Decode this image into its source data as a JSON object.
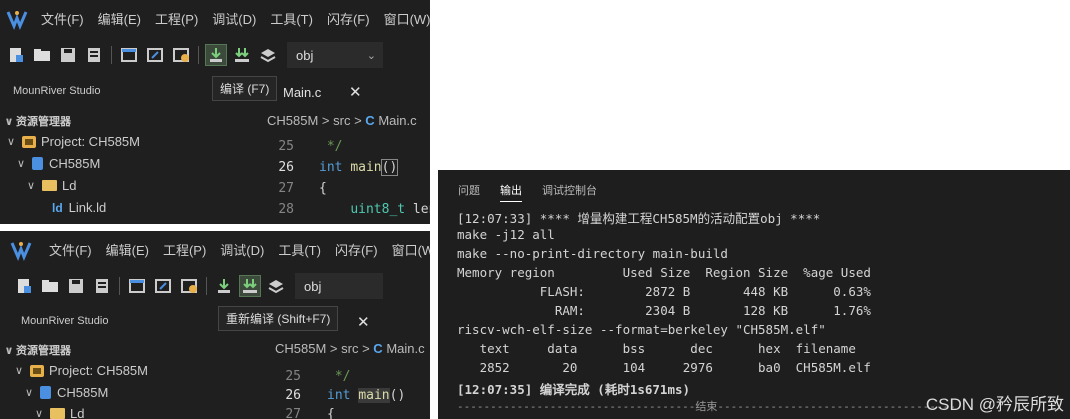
{
  "menu": [
    "文件(F)",
    "编辑(E)",
    "工程(P)",
    "调试(D)",
    "工具(T)",
    "闪存(F)",
    "窗口(W)"
  ],
  "toolbar": {
    "config_value": "obj"
  },
  "top": {
    "tooltip": "编译 (F7)",
    "tab_label": "Main.c",
    "sidebar_title": "MounRiver Studio",
    "explorer_header": "资源管理器",
    "tree": [
      {
        "label": "Project: CH585M"
      },
      {
        "label": "CH585M"
      },
      {
        "label": "Ld"
      },
      {
        "label": "Link.ld"
      }
    ],
    "breadcrumb": {
      "a": "CH585M",
      "b": "src",
      "c": "Main.c"
    },
    "lines": [
      "25",
      "26",
      "27",
      "28"
    ]
  },
  "bottom": {
    "tooltip": "重新编译 (Shift+F7)",
    "sidebar_title": "MounRiver Studio",
    "explorer_header": "资源管理器",
    "tree": [
      {
        "label": "Project: CH585M"
      },
      {
        "label": "CH585M"
      },
      {
        "label": "Ld"
      }
    ],
    "breadcrumb": {
      "a": "CH585M",
      "b": "src",
      "c": "Main.c"
    },
    "lines": [
      "25",
      "26",
      "27"
    ]
  },
  "console": {
    "tabs": [
      "问题",
      "输出",
      "调试控制台"
    ],
    "lines": [
      "[12:07:33] **** 增量构建工程CH585M的活动配置obj ****",
      "make -j12 all",
      "make --no-print-directory main-build",
      "Memory region         Used Size  Region Size  %age Used",
      "           FLASH:        2872 B       448 KB      0.63%",
      "             RAM:        2304 B       128 KB      1.76%",
      "riscv-wch-elf-size --format=berkeley \"CH585M.elf\"",
      "   text     data      bss      dec      hex  filename",
      "   2852       20      104     2976      ba0  CH585M.elf",
      "[12:07:35] 编译完成 (耗时1s671ms)",
      "------------------------------------结束------------------------------------"
    ]
  },
  "watermark": "CSDN @矜辰所致"
}
